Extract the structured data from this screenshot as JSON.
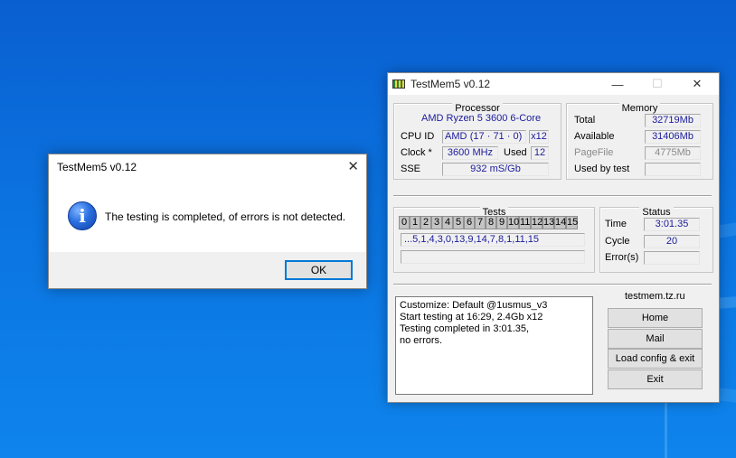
{
  "main_window": {
    "title": "TestMem5 v0.12",
    "processor": {
      "header": "Processor",
      "name": "AMD Ryzen 5 3600 6-Core",
      "cpu_id_label": "CPU ID",
      "cpu_id_vendor": "AMD",
      "cpu_id_value": "(17 · 71 · 0)",
      "cpu_id_threads": "x12",
      "clock_label": "Clock *",
      "clock_value": "3600 MHz",
      "used_label": "Used",
      "used_value": "12",
      "sse_label": "SSE",
      "sse_value": "932 mS/Gb"
    },
    "memory": {
      "header": "Memory",
      "total_label": "Total",
      "total_value": "32719Mb",
      "available_label": "Available",
      "available_value": "31406Mb",
      "pagefile_label": "PageFile",
      "pagefile_value": "4775Mb",
      "used_by_test_label": "Used by test",
      "used_by_test_value": ""
    },
    "tests": {
      "header": "Tests",
      "cells": [
        "0",
        "1",
        "2",
        "3",
        "4",
        "5",
        "6",
        "7",
        "8",
        "9",
        "10",
        "11",
        "12",
        "13",
        "14",
        "15"
      ],
      "sequence": "...5,1,4,3,0,13,9,14,7,8,1,11,15",
      "progress": ""
    },
    "status": {
      "header": "Status",
      "time_label": "Time",
      "time_value": "3:01.35",
      "cycle_label": "Cycle",
      "cycle_value": "20",
      "errors_label": "Error(s)",
      "errors_value": ""
    },
    "log": [
      "Customize: Default @1usmus_v3",
      "Start testing at 16:29, 2.4Gb x12",
      "Testing completed in 3:01.35,",
      "no errors."
    ],
    "links": {
      "header": "testmem.tz.ru",
      "home": "Home",
      "mail": "Mail",
      "load_config": "Load config & exit",
      "exit": "Exit"
    }
  },
  "dialog": {
    "title": "TestMem5 v0.12",
    "message": "The testing is completed, of errors is not detected.",
    "ok": "OK",
    "close_glyph": "✕",
    "info_glyph": "i"
  },
  "titlebar_glyphs": {
    "minimize": "—",
    "maximize": "☐",
    "close": "✕"
  }
}
